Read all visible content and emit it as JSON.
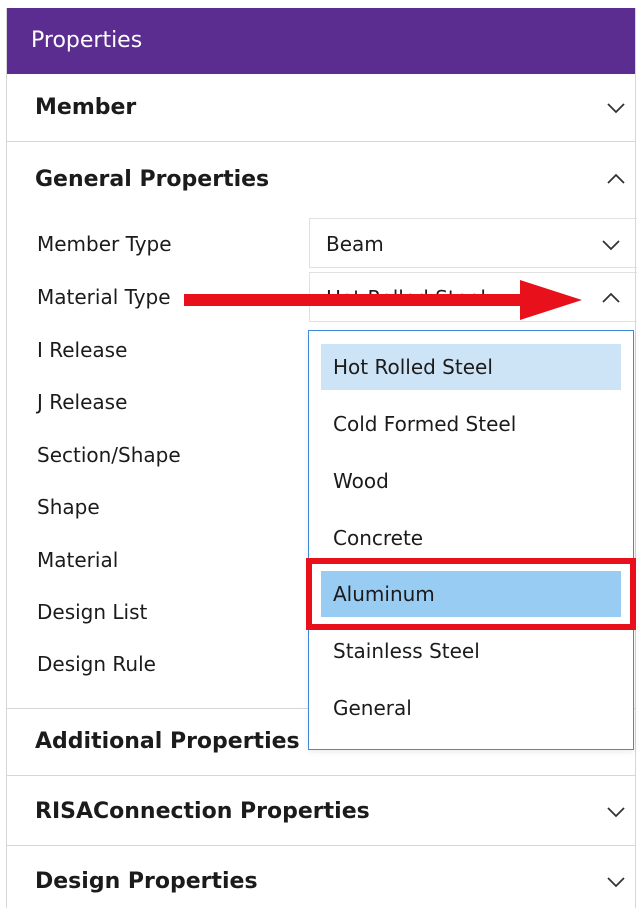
{
  "window": {
    "title": "Properties"
  },
  "sections": {
    "member": {
      "label": "Member",
      "state": "collapsed"
    },
    "general": {
      "label": "General Properties",
      "state": "expanded"
    },
    "additional": {
      "label": "Additional Properties"
    },
    "risa": {
      "label": "RISAConnection Properties",
      "state": "collapsed"
    },
    "design": {
      "label": "Design Properties",
      "state": "collapsed"
    }
  },
  "general_properties": {
    "member_type": {
      "label": "Member Type",
      "value": "Beam"
    },
    "material_type": {
      "label": "Material Type",
      "value": "Hot Rolled Steel"
    },
    "i_release": {
      "label": "I Release"
    },
    "j_release": {
      "label": "J Release"
    },
    "section_shape": {
      "label": "Section/Shape"
    },
    "shape": {
      "label": "Shape"
    },
    "material": {
      "label": "Material"
    },
    "design_list": {
      "label": "Design List"
    },
    "design_rule": {
      "label": "Design Rule"
    }
  },
  "material_dropdown": {
    "options": [
      "Hot Rolled Steel",
      "Cold Formed Steel",
      "Wood",
      "Concrete",
      "Aluminum",
      "Stainless Steel",
      "General"
    ],
    "selected": "Hot Rolled Steel",
    "highlighted": "Aluminum"
  },
  "colors": {
    "titlebar": "#5c2d91",
    "accent_border": "#3f8bd8",
    "selected_bg": "#cde4f7",
    "hover_bg": "#99ccf3",
    "annotation_red": "#e8101a"
  },
  "icons": {
    "collapsed": "chevron-down-icon",
    "expanded": "chevron-up-icon",
    "annotation_arrow": "red-arrow-icon"
  }
}
